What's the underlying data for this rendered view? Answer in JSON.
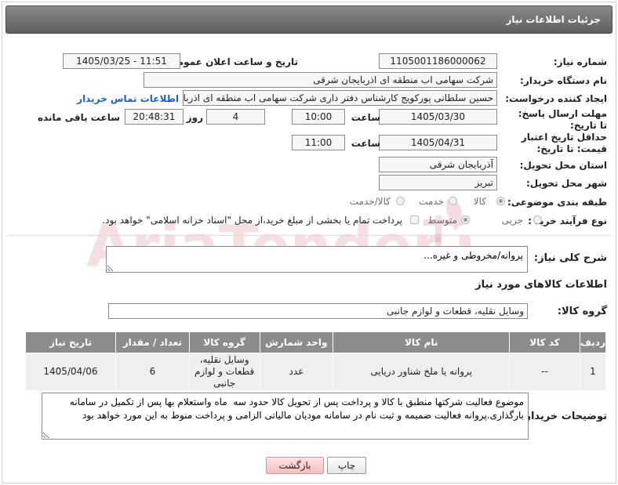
{
  "header": {
    "title": "جزئیات اطلاعات نیاز"
  },
  "need_number": {
    "label": "شماره نیاز:",
    "value": "1105001186000062"
  },
  "announce_date": {
    "label": "تاریخ و ساعت اعلان عمومی:",
    "value": "1405/03/25 - 11:51"
  },
  "buyer_org": {
    "label": "نام دستگاه خریدار:",
    "value": "شرکت سهامی اب منطقه ای اذربایجان شرقی"
  },
  "requester": {
    "label": "ایجاد کننده درخواست:",
    "value": "حسین سلطانی پورکویج کارشناس دفتر داری شرکت سهامی اب منطقه ای اذربایجان شرقی",
    "contact_link": "اطلاعات تماس خریدار"
  },
  "deadline": {
    "label": "مهلت ارسال پاسخ: تا تاریخ:",
    "date": "1405/03/30",
    "time_label": "ساعت",
    "time": "10:00",
    "days": "4",
    "days_label": "روز و",
    "remaining_time": "20:48:31",
    "remaining_label": "ساعت باقی مانده"
  },
  "price_validity": {
    "label": "حداقل تاریخ اعتبار قیمت: تا تاریخ:",
    "date": "1405/04/31",
    "time_label": "ساعت",
    "time": "11:00"
  },
  "delivery_province": {
    "label": "استان محل تحویل:",
    "value": "آذربایجان شرقی"
  },
  "delivery_city": {
    "label": "شهر محل تحویل:",
    "value": "تبریز"
  },
  "category": {
    "label": "طبقه بندی موضوعی:",
    "options": [
      "کالا",
      "خدمت",
      "کالا/خدمت"
    ],
    "selected": "کالا"
  },
  "purchase_process": {
    "label": "نوع فرآیند خرید :",
    "options": [
      "جزیی",
      "متوسط"
    ],
    "selected": "متوسط",
    "note": "پرداخت تمام یا بخشی از مبلغ خرید،از محل \"اسناد خزانه اسلامی\" خواهد بود."
  },
  "description": {
    "label": "شرح کلی نیاز:",
    "value": "پروانه/مخروطی و غیره..."
  },
  "goods_section": {
    "title": "اطلاعات کالاهای مورد نیاز"
  },
  "goods_group": {
    "label": "گروه کالا:",
    "value": "وسایل نقلیه، قطعات و لوازم جانبی"
  },
  "goods_table": {
    "headers": [
      "ردیف",
      "کد کالا",
      "نام کالا",
      "واحد شمارش",
      "گروه کالا",
      "تعداد / مقدار",
      "تاریخ نیاز"
    ],
    "rows": [
      {
        "row": "1",
        "code": "--",
        "name": "پروانه یا ملخ شناور دریایی",
        "unit": "عدد",
        "group": "وسایل نقلیه، قطعات و لوازم جانبی",
        "qty": "6",
        "date": "1405/04/06"
      }
    ]
  },
  "buyer_notes": {
    "label": "توضیحات خریدار:",
    "value": "موضوع فعالیت شرکتها منطبق با کالا و پرداخت پس از تحویل کالا حدود سه  ماه واستعلام بها پس از تکمیل در سامانه بارگذاری.پروانه فعالیت ضمیمه و ثبت نام در سامانه مودیان مالیاتی الزامی و پرداخت منوط به این مورد خواهد بود"
  },
  "buttons": {
    "print": "چاپ",
    "back": "بازگشت"
  },
  "watermark": {
    "text": "AriaTender.net"
  },
  "colors": {
    "header_bg": "#6f6f6f",
    "table_header_bg": "#8c8c8c",
    "link": "#1f5fbf",
    "back_button": "#f6bfbf"
  }
}
